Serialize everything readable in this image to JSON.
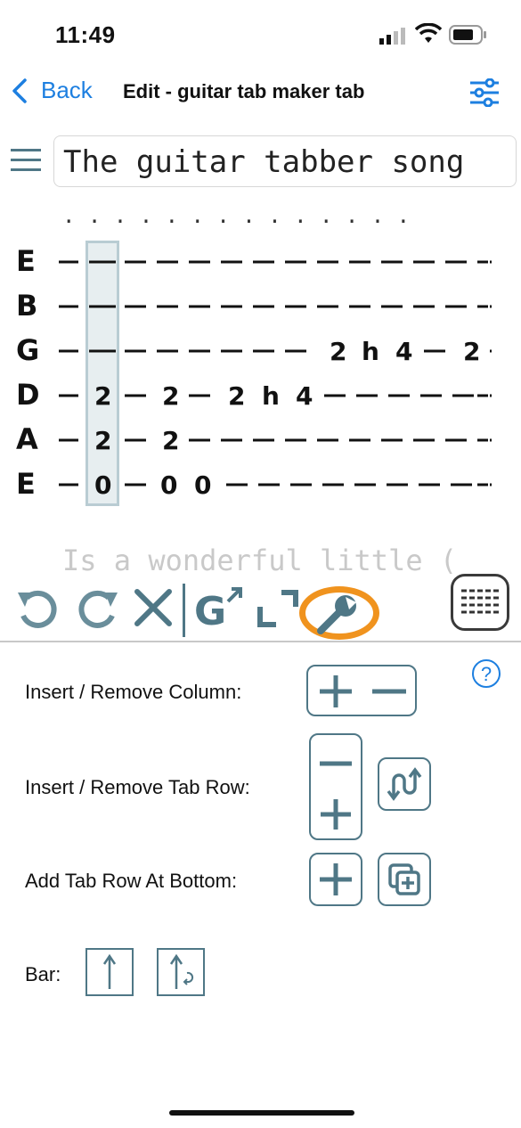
{
  "status_bar": {
    "time": "11:49"
  },
  "nav": {
    "back_label": "Back",
    "title": "Edit - guitar tab maker tab"
  },
  "song": {
    "title": "The guitar tabber song"
  },
  "tab": {
    "dots": ". . . . . . . . . . . . . .",
    "strings": [
      {
        "name": "E",
        "line": "————————————————-"
      },
      {
        "name": "B",
        "line": "————————————————-"
      },
      {
        "name": "G",
        "line": "————————— 2 h 4 — 2 -"
      },
      {
        "name": "D",
        "line": "— 2 — 2 — 2 h 4 ——————-"
      },
      {
        "name": "A",
        "line": "— 2 — 2 ——————————————-"
      },
      {
        "name": "E",
        "line": "— 0 — 0 0 ————————————-"
      }
    ]
  },
  "lyrics": "Is a wonderful little (",
  "lower_panel": {
    "insert_remove_column": "Insert / Remove Column:",
    "insert_remove_tab_row": "Insert / Remove Tab Row:",
    "add_tab_row_bottom": "Add Tab Row At Bottom:",
    "bar": "Bar:",
    "help": "?"
  },
  "colors": {
    "accent": "#1d7fe0",
    "icon": "#4f7786",
    "highlight": "#f0931e"
  }
}
